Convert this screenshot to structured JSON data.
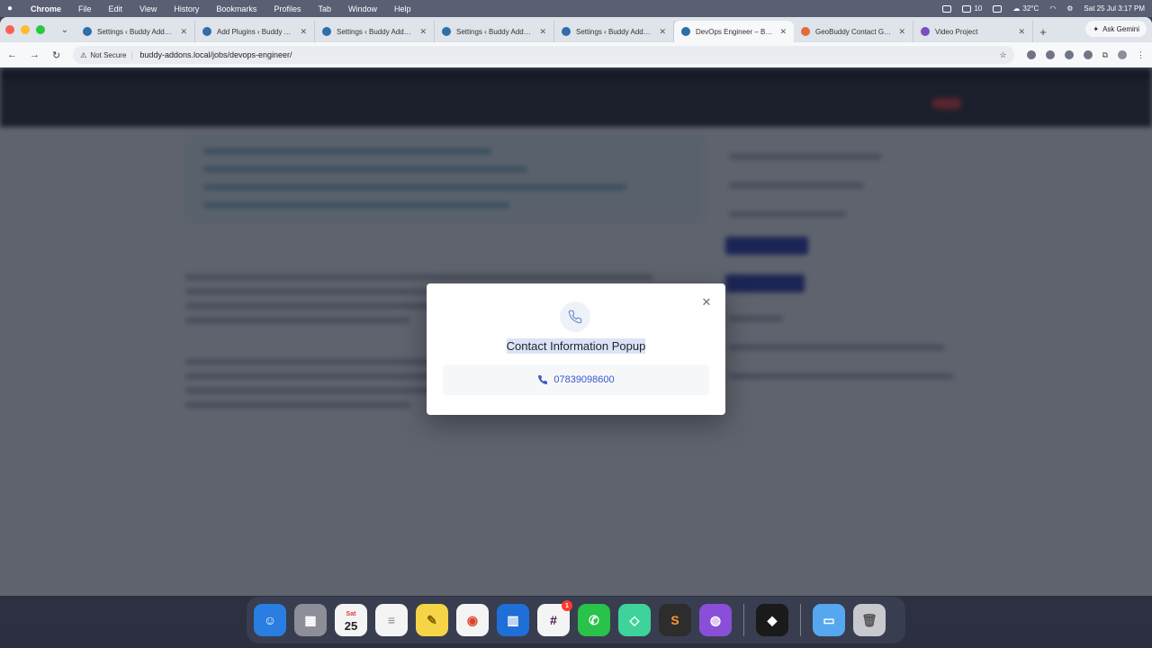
{
  "menubar": {
    "app_name": "Chrome",
    "items": [
      "File",
      "Edit",
      "View",
      "History",
      "Bookmarks",
      "Profiles",
      "Tab",
      "Window",
      "Help"
    ],
    "status": {
      "notifications": "10",
      "temperature": "32°C",
      "datetime": "Sat 25 Jul  3:17 PM"
    }
  },
  "browser": {
    "tabs": [
      {
        "title": "Settings ‹ Buddy Add…",
        "icon": "wordpress-icon"
      },
      {
        "title": "Add Plugins ‹ Buddy A…",
        "icon": "wordpress-icon"
      },
      {
        "title": "Settings ‹ Buddy Add…",
        "icon": "wordpress-icon"
      },
      {
        "title": "Settings ‹ Buddy Add…",
        "icon": "wordpress-icon"
      },
      {
        "title": "Settings ‹ Buddy Add…",
        "icon": "wordpress-icon"
      },
      {
        "title": "DevOps Engineer – Bu…",
        "icon": "wordpress-icon",
        "active": true
      },
      {
        "title": "GeoBuddy Contact G…",
        "icon": "geobuddy-icon"
      },
      {
        "title": "Video Project",
        "icon": "video-icon"
      }
    ],
    "ask_gemini": "Ask Gemini",
    "security_label": "Not Secure",
    "url": "buddy-addons.local/jobs/devops-engineer/"
  },
  "modal": {
    "title": "Contact Information Popup",
    "phone": "07839098600",
    "close_symbol": "✕"
  },
  "dock": {
    "calendar_day": "25",
    "calendar_month": "Sat",
    "slack_badge": "1"
  }
}
